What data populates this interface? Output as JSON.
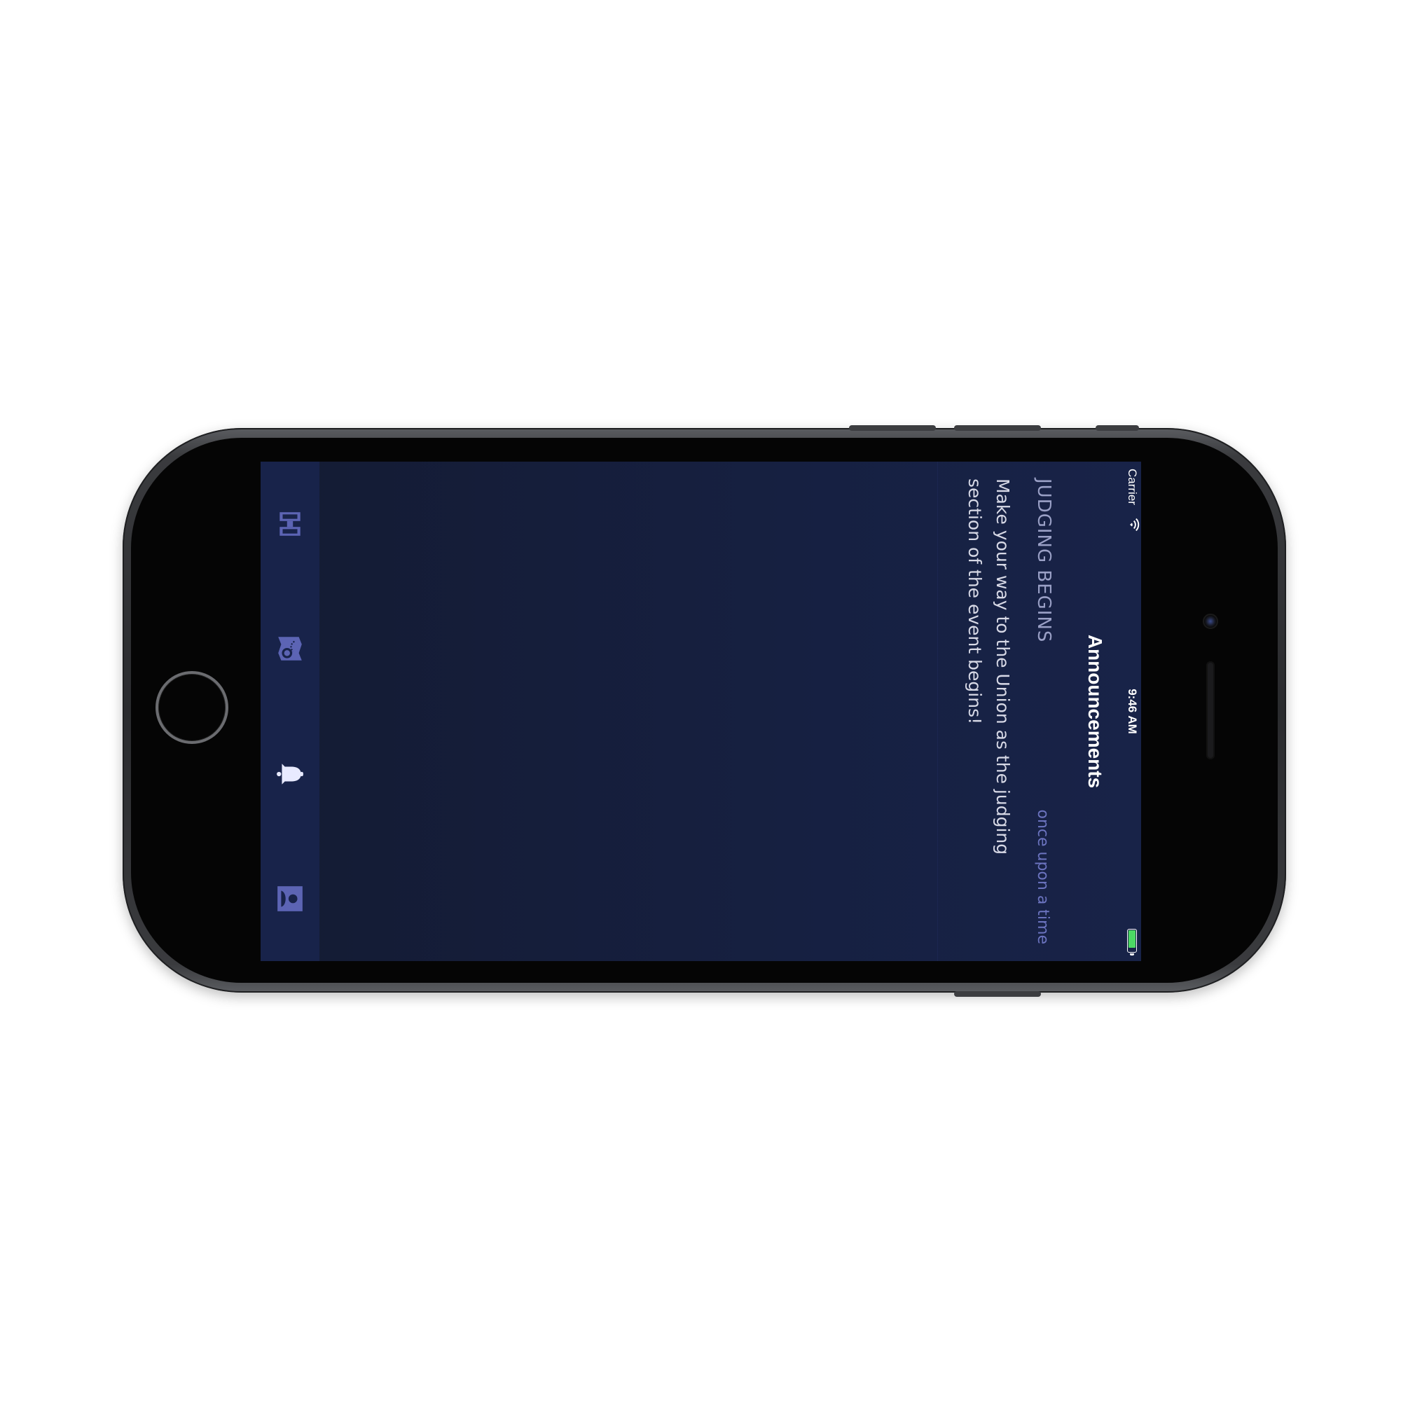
{
  "status_bar": {
    "carrier": "Carrier",
    "time": "9:46 AM"
  },
  "nav": {
    "title": "Announcements"
  },
  "announcements": [
    {
      "title": "JUDGING BEGINS",
      "time": "once upon a time",
      "body": "Make your way to the Union as the judging section of the event begins!"
    }
  ],
  "tabs": [
    {
      "name": "schedule-icon",
      "active": false
    },
    {
      "name": "map-icon",
      "active": false
    },
    {
      "name": "bell-icon",
      "active": true
    },
    {
      "name": "profile-icon",
      "active": false
    }
  ],
  "colors": {
    "background": "#162041",
    "tab_bar": "#18234a",
    "accent": "#6c74c0",
    "active_tab": "#e8eaff",
    "inactive_tab": "#5c64b4"
  }
}
